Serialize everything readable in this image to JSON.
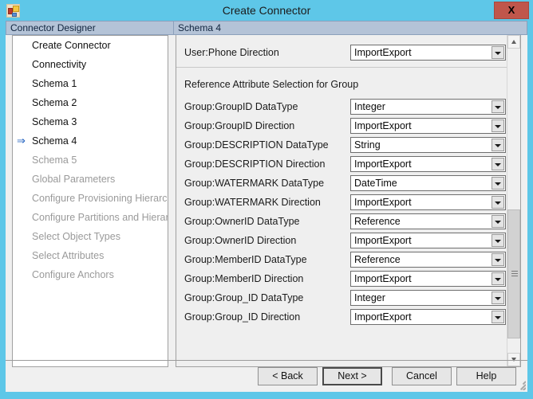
{
  "window": {
    "title": "Create Connector",
    "close_label": "X",
    "app_icon": "connector-app-icon"
  },
  "panels": {
    "left_header": "Connector Designer",
    "right_header": "Schema 4"
  },
  "sidebar": {
    "items": [
      {
        "label": "Create Connector",
        "state": "completed",
        "active": false
      },
      {
        "label": "Connectivity",
        "state": "completed",
        "active": false
      },
      {
        "label": "Schema 1",
        "state": "completed",
        "active": false
      },
      {
        "label": "Schema 2",
        "state": "completed",
        "active": false
      },
      {
        "label": "Schema 3",
        "state": "completed",
        "active": false
      },
      {
        "label": "Schema 4",
        "state": "active",
        "active": true
      },
      {
        "label": "Schema 5",
        "state": "disabled",
        "active": false
      },
      {
        "label": "Global Parameters",
        "state": "disabled",
        "active": false
      },
      {
        "label": "Configure Provisioning Hierarchy",
        "state": "disabled",
        "active": false
      },
      {
        "label": "Configure Partitions and Hierarchies",
        "state": "disabled",
        "active": false
      },
      {
        "label": "Select Object Types",
        "state": "disabled",
        "active": false
      },
      {
        "label": "Select Attributes",
        "state": "disabled",
        "active": false
      },
      {
        "label": "Configure Anchors",
        "state": "disabled",
        "active": false
      }
    ],
    "active_marker_icon": "right-arrow-icon"
  },
  "content": {
    "top_row": {
      "label": "User:Phone Direction",
      "value": "ImportExport"
    },
    "section_title": "Reference Attribute Selection for Group",
    "rows": [
      {
        "label": "Group:GroupID DataType",
        "value": "Integer"
      },
      {
        "label": "Group:GroupID Direction",
        "value": "ImportExport"
      },
      {
        "label": "Group:DESCRIPTION DataType",
        "value": "String"
      },
      {
        "label": "Group:DESCRIPTION Direction",
        "value": "ImportExport"
      },
      {
        "label": "Group:WATERMARK DataType",
        "value": "DateTime"
      },
      {
        "label": "Group:WATERMARK Direction",
        "value": "ImportExport"
      },
      {
        "label": "Group:OwnerID DataType",
        "value": "Reference"
      },
      {
        "label": "Group:OwnerID Direction",
        "value": "ImportExport"
      },
      {
        "label": "Group:MemberID DataType",
        "value": "Reference"
      },
      {
        "label": "Group:MemberID Direction",
        "value": "ImportExport"
      },
      {
        "label": "Group:Group_ID DataType",
        "value": "Integer"
      },
      {
        "label": "Group:Group_ID Direction",
        "value": "ImportExport"
      }
    ],
    "scrollbar": {
      "up_icon": "chevron-up-icon",
      "down_icon": "chevron-down-icon"
    }
  },
  "footer": {
    "back": "< Back",
    "next": "Next >",
    "cancel": "Cancel",
    "help": "Help"
  },
  "colors": {
    "window_frame": "#5ec7e8",
    "dialog_bg": "#f0f0f0",
    "panel_header": "#b4c3d7",
    "close_button": "#c0564b",
    "active_arrow": "#1f5fbf",
    "disabled_text": "#9a9a9a"
  }
}
